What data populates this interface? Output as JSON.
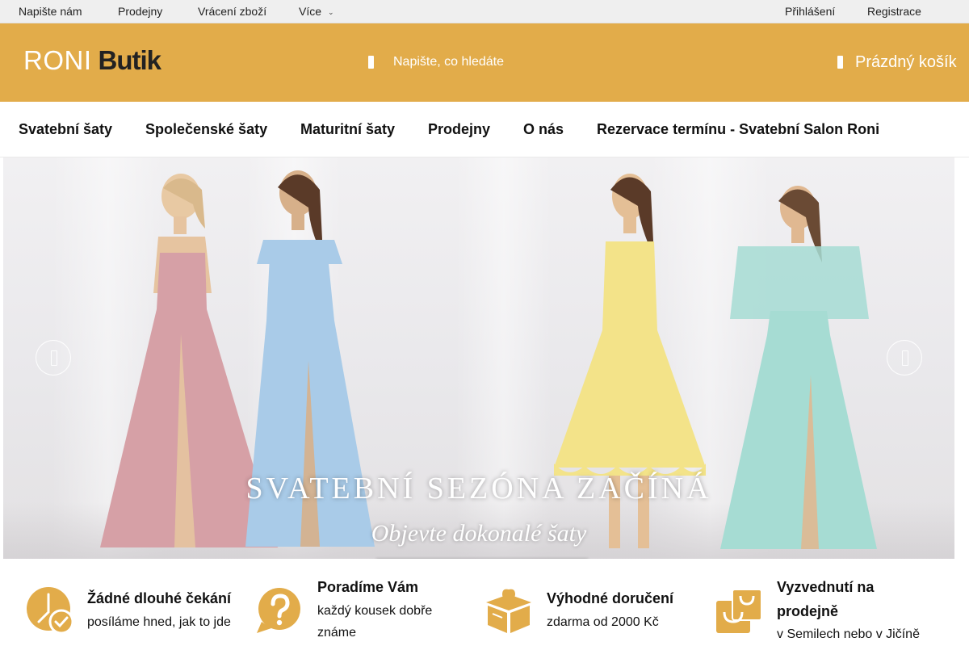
{
  "topbar": {
    "links": [
      "Napište nám",
      "Prodejny",
      "Vrácení zboží",
      "Více"
    ],
    "more_caret": "⌄",
    "login": "Přihlášení",
    "register": "Registrace"
  },
  "header": {
    "logo_part1": "RONI",
    "logo_part2": "Butik",
    "search_placeholder": "Napište, co hledáte",
    "search_icon": "search-icon",
    "cart_label": "Prázdný košík",
    "cart_icon": "cart-icon",
    "brand_color": "#e2ac4a"
  },
  "nav": {
    "items": [
      "Svatební šaty",
      "Společenské šaty",
      "Maturitní šaty",
      "Prodejny",
      "O nás",
      "Rezervace termínu - Svatební Salon Roni"
    ]
  },
  "banner": {
    "headline": "SVATEBNÍ SEZÓNA ZAČÍNÁ",
    "subline": "Objevte dokonalé šaty",
    "prev_icon": "chevron-left-icon",
    "next_icon": "chevron-right-icon",
    "dress_colors": [
      "#d6a0a6",
      "#a9cbe8",
      "#f3e389",
      "#a6dcd3"
    ]
  },
  "features": [
    {
      "icon": "clock-check-icon",
      "title": "Žádné dlouhé čekání",
      "desc": [
        "posíláme hned, jak to jde"
      ]
    },
    {
      "icon": "question-bubble-icon",
      "title": "Poradíme Vám",
      "desc": [
        "každý kousek dobře",
        "známe"
      ]
    },
    {
      "icon": "gift-box-icon",
      "title": "Výhodné doručení",
      "desc": [
        "zdarma od 2000 Kč"
      ]
    },
    {
      "icon": "shopping-bag-icon",
      "title": "Vyzvednutí na prodejně",
      "desc": [
        "v Semilech nebo v Jičíně"
      ]
    }
  ],
  "accent_color": "#e2ac4a"
}
